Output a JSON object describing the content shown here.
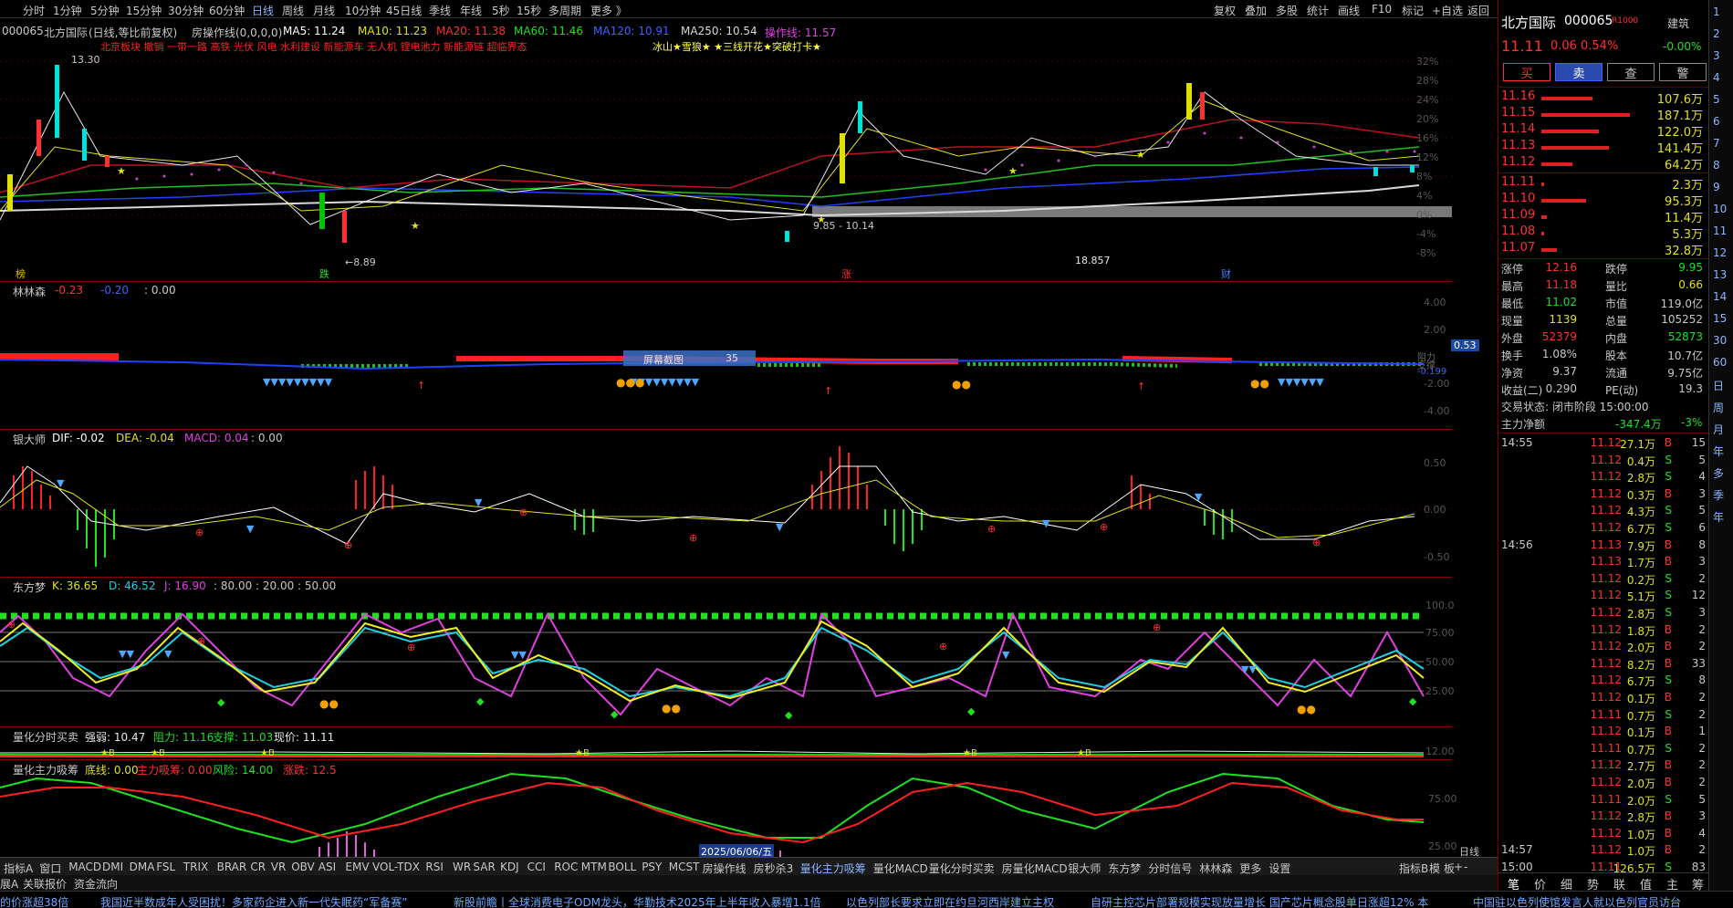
{
  "toolbar": {
    "periods": [
      "分时",
      "1分钟",
      "5分钟",
      "15分钟",
      "30分钟",
      "60分钟",
      "日线",
      "周线",
      "月线",
      "10分钟",
      "45日线",
      "季线",
      "年线",
      "5秒",
      "15秒",
      "多周期",
      "更多 》"
    ],
    "active_period": "日线",
    "right_tools": [
      "复权",
      "叠加",
      "多股",
      "统计",
      "画线",
      "F10",
      "标记",
      "+自选",
      "返回"
    ]
  },
  "main": {
    "code": "000065",
    "name": "北方国际",
    "mode": "(日线,等比前复权)",
    "indicator": "房操作线(0,0,0,0)",
    "ma5": "MA5: 11.24",
    "ma10": "MA10: 11.23",
    "ma20": "MA20: 11.38",
    "ma60": "MA60: 11.46",
    "ma120": "MA120: 10.91",
    "ma250": "MA250: 10.54",
    "op": "操作线: 11.57",
    "signal_row": "北京板块      撤销      一带一路 高铁 光伏 风电 水利建设 新能源车 无人机 锂电池力 新能源链 超临界态",
    "signal_tail": "冰山★雪狼★  ★三线开花★突破打卡★",
    "high_label": "13.30",
    "low_label": "←8.89",
    "range_label": "9.85 - 10.14",
    "mid_value": "18.857",
    "bottom_tags": [
      "榜",
      "跌",
      "涨",
      "财"
    ],
    "axis": [
      "32%",
      "28%",
      "24%",
      "20%",
      "16%",
      "12%",
      "8%",
      "4%",
      "0%",
      "-4%",
      "-8%"
    ]
  },
  "panel_lls": {
    "title": "林林森",
    "v1": "-0.23",
    "v2": "-0.20",
    "v3": ": 0.00",
    "tip_label": "屏幕截图",
    "tip_value": "35",
    "current": "0.53",
    "curr2": "-0.199",
    "axis": [
      "4.00",
      "2.00",
      "0.00",
      "-2.00",
      "-4.00"
    ],
    "side": [
      "阻力",
      "支撑"
    ]
  },
  "panel_macd": {
    "title": "银大师",
    "dif": "DIF: -0.02",
    "dea": "DEA: -0.04",
    "macd": "MACD: 0.04",
    "extra": ": 0.00",
    "axis": [
      "0.50",
      "0.00",
      "-0.50"
    ]
  },
  "panel_kdj": {
    "title": "东方梦",
    "k": "K: 36.65",
    "d": "D: 46.52",
    "j": "J: 16.90",
    "levels": ": 80.00 : 20.00 : 50.00",
    "axis": [
      "100.0",
      "75.00",
      "50.00",
      "25.00"
    ]
  },
  "panel_qfs": {
    "title": "量化分时买卖",
    "strong": "强弱: 10.47",
    "resist": "阻力: 11.16",
    "support": "支撑: 11.03",
    "price": "现价: 11.11",
    "axis": "12.00"
  },
  "panel_qzl": {
    "title": "量化主力吸筹",
    "base": "底线: 0.00",
    "main": "主力吸筹: 0.00",
    "risk": "风险: 14.00",
    "rise": "涨跌: 12.5",
    "axis": [
      "75.00",
      "25.00"
    ],
    "date_label": "2025/06/06/五"
  },
  "bottom_tabs": [
    "指标A",
    "窗口",
    "MACD",
    "DMI",
    "DMA",
    "FSL",
    "TRIX",
    "BRAR",
    "CR",
    "VR",
    "OBV",
    "ASI",
    "EMV",
    "VOL-TDX",
    "RSI",
    "WR",
    "SAR",
    "KDJ",
    "CCI",
    "ROC",
    "MTM",
    "BOLL",
    "PSY",
    "MCST",
    "房操作线",
    "房秒杀3",
    "量化主力吸筹",
    "量化MACD",
    "量化分时买卖",
    "房量化MACD",
    "银大师",
    "东方梦",
    "分时信号",
    "林林森",
    "更多",
    "设置"
  ],
  "bottom_tabs_active": "量化主力吸筹",
  "bottom_tabs_right": [
    "指标B",
    "模",
    "板",
    "+",
    "-"
  ],
  "axis_mode": "日线",
  "bottom_row2": [
    "展A",
    "关联报价",
    "资金流向"
  ],
  "ticker": [
    "的价涨超38倍",
    "我国近半数成年人受困扰！多家药企进入新一代失眠药“军备赛”",
    "新股前瞻丨全球消费电子ODM龙头，华勤技术2025年上半年收入暴增1.1倍",
    "以色列部长要求立即在约旦河西岸建立主权",
    "自研主控芯片部署规模实现放量增长 国产芯片概念股单日涨超12% 本",
    "中国驻以色列使馆发言人就以色列官员访台"
  ],
  "quote": {
    "name": "北方国际",
    "code": "000065",
    "r_icon": "R1000",
    "sector": "建筑",
    "sector_pct": "-0.00%",
    "price": "11.11",
    "chg": "0.06",
    "pct": "0.54%",
    "buttons": [
      "买",
      "卖",
      "查",
      "警"
    ],
    "asks": [
      {
        "p": "11.16",
        "v": "107.6万"
      },
      {
        "p": "11.15",
        "v": "187.1万"
      },
      {
        "p": "11.14",
        "v": "122.0万"
      },
      {
        "p": "11.13",
        "v": "141.4万"
      },
      {
        "p": "11.12",
        "v": "64.2万"
      }
    ],
    "bids": [
      {
        "p": "11.11",
        "v": "2.3万"
      },
      {
        "p": "11.10",
        "v": "95.3万"
      },
      {
        "p": "11.09",
        "v": "11.4万"
      },
      {
        "p": "11.08",
        "v": "5.3万"
      },
      {
        "p": "11.07",
        "v": "32.8万"
      }
    ],
    "ask_bar": [
      0.58,
      1.0,
      0.65,
      0.76,
      0.35
    ],
    "bid_bar": [
      0.02,
      0.51,
      0.06,
      0.03,
      0.18
    ],
    "stats": [
      {
        "a": "涨停",
        "b": "12.16",
        "c": "跌停",
        "d": "9.95"
      },
      {
        "a": "最高",
        "b": "11.18",
        "c": "量比",
        "d": "0.66"
      },
      {
        "a": "最低",
        "b": "11.02",
        "c": "市值",
        "d": "119.0亿"
      },
      {
        "a": "现量",
        "b": "1139",
        "c": "总量",
        "d": "105252"
      },
      {
        "a": "外盘",
        "b": "52379",
        "c": "内盘",
        "d": "52873"
      },
      {
        "a": "换手",
        "b": "1.08%",
        "c": "股本",
        "d": "10.7亿"
      },
      {
        "a": "净资",
        "b": "9.37",
        "c": "流通",
        "d": "9.75亿"
      },
      {
        "a": "收益(二)",
        "b": "0.290",
        "c": "PE(动)",
        "d": "19.3"
      }
    ],
    "status": "交易状态: 闭市阶段 15:00:00",
    "flow_label": "主力净额",
    "flow_value": "-347.4万",
    "flow_pct": "-3%",
    "ticks": [
      {
        "t": "14:55",
        "p": "11.12",
        "v": "27.1万",
        "d": "B",
        "n": "15"
      },
      {
        "t": "",
        "p": "11.12",
        "v": "0.4万",
        "d": "S",
        "n": "5"
      },
      {
        "t": "",
        "p": "11.12",
        "v": "2.8万",
        "d": "S",
        "n": "4"
      },
      {
        "t": "",
        "p": "11.12",
        "v": "0.3万",
        "d": "B",
        "n": "3"
      },
      {
        "t": "",
        "p": "11.12",
        "v": "4.3万",
        "d": "S",
        "n": "5"
      },
      {
        "t": "",
        "p": "11.12",
        "v": "6.7万",
        "d": "S",
        "n": "6"
      },
      {
        "t": "14:56",
        "p": "11.13",
        "v": "7.9万",
        "d": "B",
        "n": "8"
      },
      {
        "t": "",
        "p": "11.13",
        "v": "1.7万",
        "d": "B",
        "n": "3"
      },
      {
        "t": "",
        "p": "11.12",
        "v": "0.2万",
        "d": "S",
        "n": "2"
      },
      {
        "t": "",
        "p": "11.12",
        "v": "5.1万",
        "d": "S",
        "n": "12"
      },
      {
        "t": "",
        "p": "11.12",
        "v": "2.8万",
        "d": "S",
        "n": "3"
      },
      {
        "t": "",
        "p": "11.12",
        "v": "1.8万",
        "d": "B",
        "n": "2"
      },
      {
        "t": "",
        "p": "11.12",
        "v": "2.0万",
        "d": "B",
        "n": "2"
      },
      {
        "t": "",
        "p": "11.12",
        "v": "8.2万",
        "d": "B",
        "n": "33"
      },
      {
        "t": "",
        "p": "11.12",
        "v": "6.7万",
        "d": "S",
        "n": "8"
      },
      {
        "t": "",
        "p": "11.12",
        "v": "0.1万",
        "d": "B",
        "n": "2"
      },
      {
        "t": "",
        "p": "11.11",
        "v": "0.7万",
        "d": "S",
        "n": "2"
      },
      {
        "t": "",
        "p": "11.12",
        "v": "0.1万",
        "d": "B",
        "n": "1"
      },
      {
        "t": "",
        "p": "11.11",
        "v": "0.7万",
        "d": "S",
        "n": "2"
      },
      {
        "t": "",
        "p": "11.12",
        "v": "2.7万",
        "d": "B",
        "n": "2"
      },
      {
        "t": "",
        "p": "11.12",
        "v": "2.0万",
        "d": "B",
        "n": "2"
      },
      {
        "t": "",
        "p": "11.11",
        "v": "2.0万",
        "d": "S",
        "n": "5"
      },
      {
        "t": "",
        "p": "11.12",
        "v": "2.8万",
        "d": "B",
        "n": "3"
      },
      {
        "t": "",
        "p": "11.12",
        "v": "1.0万",
        "d": "B",
        "n": "4"
      },
      {
        "t": "14:57",
        "p": "11.12",
        "v": "1.0万",
        "d": "B",
        "n": "2"
      },
      {
        "t": "15:00",
        "p": "11.11",
        "v": "126.5万",
        "d": "S",
        "n": "83"
      }
    ],
    "bottom_tabs": [
      "笔",
      "价",
      "细",
      "势",
      "联",
      "值",
      "主",
      "筹"
    ]
  },
  "rail": [
    "1",
    "2",
    "3",
    "4",
    "5",
    "6",
    "7",
    "8",
    "9",
    "10",
    "11",
    "12",
    "13",
    "14",
    "15",
    "30",
    "60",
    "日",
    "周",
    "月",
    "年",
    "多",
    "季",
    "年"
  ]
}
